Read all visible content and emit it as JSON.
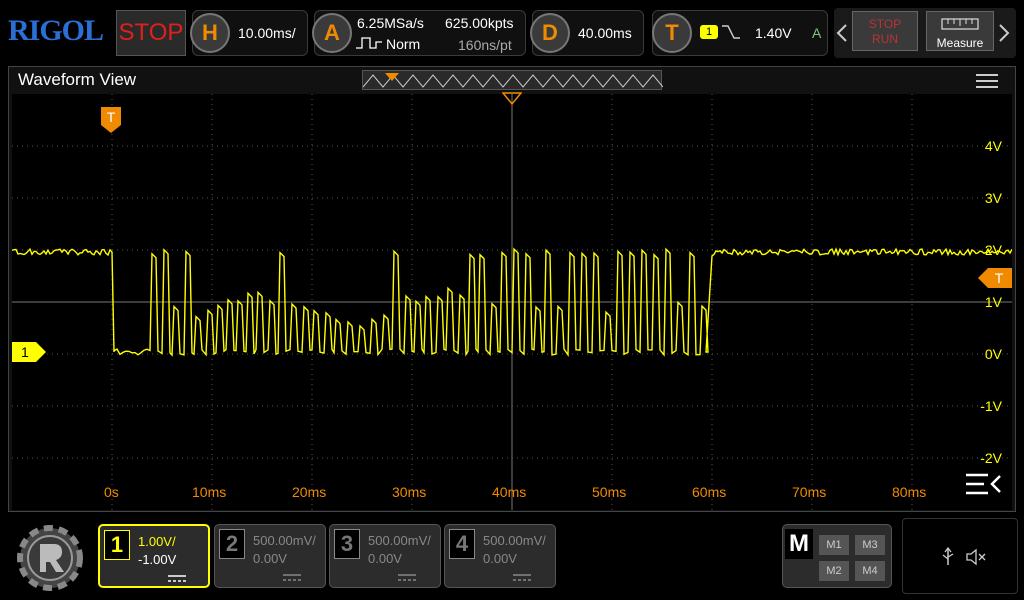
{
  "brand": "RIGOL",
  "run_state": "STOP",
  "horizontal": {
    "letter": "H",
    "scale": "10.00ms/"
  },
  "acquire": {
    "letter": "A",
    "sample_rate": "6.25MSa/s",
    "mode": "Norm",
    "memory_depth": "625.00kpts",
    "resolution": "160ns/pt"
  },
  "delay": {
    "letter": "D",
    "value": "40.00ms"
  },
  "trigger": {
    "letter": "T",
    "source": "1",
    "level": "1.40V",
    "mode": "A"
  },
  "controls": {
    "stop_label": "STOP",
    "run_label": "RUN",
    "measure_label": "Measure"
  },
  "waveform_view": {
    "title": "Waveform View",
    "trigger_marker": "T",
    "right_trigger_marker": "T",
    "channel_marker": "1",
    "y_labels": [
      "4V",
      "3V",
      "2V",
      "1V",
      "0V",
      "-1V",
      "-2V"
    ],
    "x_labels": [
      "0s",
      "10ms",
      "20ms",
      "30ms",
      "40ms",
      "50ms",
      "60ms",
      "70ms",
      "80ms"
    ]
  },
  "channels": [
    {
      "num": "1",
      "scale": "1.00V/",
      "offset": "-1.00V",
      "active": true
    },
    {
      "num": "2",
      "scale": "500.00mV/",
      "offset": "0.00V",
      "active": false
    },
    {
      "num": "3",
      "scale": "500.00mV/",
      "offset": "0.00V",
      "active": false
    },
    {
      "num": "4",
      "scale": "500.00mV/",
      "offset": "0.00V",
      "active": false
    }
  ],
  "math": {
    "letter": "M",
    "items": [
      "M1",
      "M3",
      "M2",
      "M4"
    ]
  },
  "colors": {
    "ch1": "#ffff00",
    "accent": "#f08a00",
    "stop": "#e0201a",
    "brand": "#2a6fd6"
  }
}
